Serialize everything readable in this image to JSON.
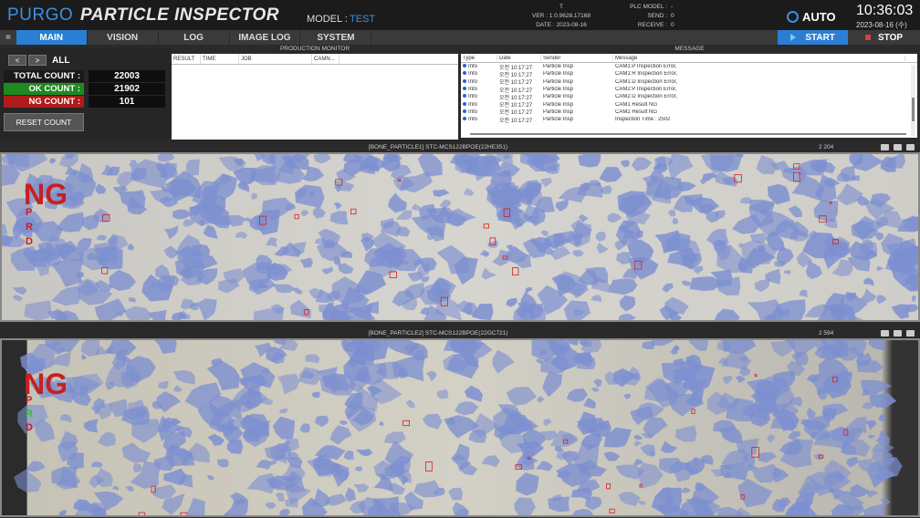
{
  "header": {
    "brand": "PURGO",
    "title": "PARTICLE INSPECTOR",
    "model_label": "MODEL :",
    "model_value": "TEST",
    "status_t": "T",
    "version": "VER : 1.0.9628.17168",
    "date": "DATE : 2023-08-16",
    "plc_model_label": "PLC MODEL :",
    "plc_model_value": "-",
    "send_label": "SEND :",
    "send_value": "0",
    "receive_label": "RECEIVE :",
    "receive_value": "0",
    "mode": "AUTO",
    "time": "10:36:03",
    "clock_date": "2023-08-16 (수)"
  },
  "nav": {
    "tabs": [
      "MAIN",
      "VISION",
      "LOG",
      "IMAGE LOG",
      "SYSTEM"
    ],
    "active": "MAIN",
    "start": "START",
    "stop": "STOP"
  },
  "counts": {
    "filter": "ALL",
    "total_label": "TOTAL COUNT :",
    "total_value": "22003",
    "ok_label": "OK COUNT :",
    "ok_value": "21902",
    "ng_label": "NG COUNT :",
    "ng_value": "101",
    "reset_label": "RESET COUNT"
  },
  "production": {
    "title": "PRODUCTION MONITOR",
    "columns": [
      "RESULT",
      "TIME",
      "JOB",
      "CAMN..."
    ]
  },
  "message": {
    "title": "MESSAGE",
    "columns": [
      "Type",
      "Date",
      "Sender",
      "Message"
    ],
    "rows": [
      {
        "type": "Info",
        "date": "오전 10:17:27",
        "sender": "Particle Insp",
        "message": "CAM1:P Inspection Error,"
      },
      {
        "type": "Info",
        "date": "오전 10:17:27",
        "sender": "Particle Insp",
        "message": "CAM1:R Inspection Error,"
      },
      {
        "type": "Info",
        "date": "오전 10:17:27",
        "sender": "Particle Insp",
        "message": "CAM1:D Inspection Error,"
      },
      {
        "type": "Info",
        "date": "오전 10:17:27",
        "sender": "Particle Insp",
        "message": "CAM2:P Inspection Error,"
      },
      {
        "type": "Info",
        "date": "오전 10:17:27",
        "sender": "Particle Insp",
        "message": "CAM2:D Inspection Error,"
      },
      {
        "type": "Info",
        "date": "오전 10:17:27",
        "sender": "Particle Insp",
        "message": "CAM1 Result NG"
      },
      {
        "type": "Info",
        "date": "오전 10:17:27",
        "sender": "Particle Insp",
        "message": "CAM2 Result NG"
      },
      {
        "type": "Info",
        "date": "오전 10:17:27",
        "sender": "Particle Insp",
        "message": "Inspection Time : 2502"
      }
    ]
  },
  "cameras": [
    {
      "title": "[BONE_PARTICLE1] STC-MCS122BPOE(22HE351)",
      "stat": "2 204",
      "result": "NG",
      "letters": [
        "P",
        "R",
        "D"
      ]
    },
    {
      "title": "[BONE_PARTICLE2] STC-MCS122BPOE(22GC721)",
      "stat": "2 594",
      "result": "NG",
      "letters": [
        "P",
        "R",
        "D"
      ]
    }
  ],
  "colors": {
    "accent": "#2a7fd4",
    "ok": "#1f8a1f",
    "ng": "#b01b1b",
    "r_green": "#2fbf2f"
  }
}
